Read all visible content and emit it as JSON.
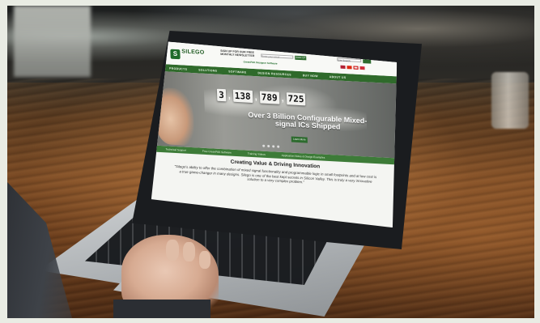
{
  "site": {
    "logo_text": "SILEGO",
    "signup_text": "SIGN UP FOR OUR FREE MONTHLY NEWSLETTER",
    "signup_placeholder": "Enter your email",
    "signup_button": "SIGN UP",
    "search_placeholder": "Site Search",
    "promo_link": "GreenPAK Designer Software",
    "nav": [
      "PRODUCTS",
      "SOLUTIONS",
      "SOFTWARE",
      "DESIGN RESOURCES",
      "BUY NOW",
      "ABOUT US"
    ],
    "hero": {
      "counter": [
        "3",
        "138",
        "789",
        "725"
      ],
      "title": "Over 3 Billion Configurable Mixed-signal ICs Shipped",
      "button": "Learn More"
    },
    "quick_links": [
      "Technical Support",
      "Free GreenPAK Software",
      "Training Videos",
      "Application Notes & Design Examples"
    ],
    "headline": "Creating Value & Driving Innovation",
    "quote": "\"Silego's ability to offer the combination of mixed signal functionality and programmable logic in small footprints and at low cost is a true game-changer in many designs. Silego is one of the best kept secrets in Silicon Valley. This is truly a very innovative solution to a very complex problem.\""
  },
  "colors": {
    "brand_green": "#2f6a2b",
    "wood": "#7a4a24"
  }
}
